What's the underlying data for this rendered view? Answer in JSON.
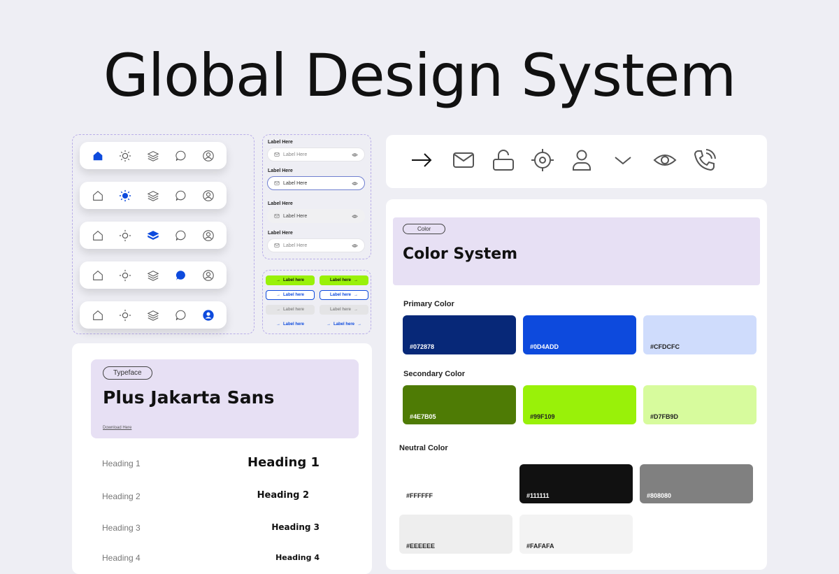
{
  "title": "Global Design System",
  "inputs": {
    "fields": [
      {
        "label": "Label Here",
        "placeholder": "Label Here"
      },
      {
        "label": "Label Here",
        "placeholder": "Label Here"
      },
      {
        "label": "Label Here",
        "placeholder": "Label Here"
      },
      {
        "label": "Label Here",
        "placeholder": "Label Here"
      }
    ]
  },
  "buttons": {
    "labels": [
      "Label here",
      "Label here",
      "Label here",
      "Label here",
      "Label here",
      "Label here",
      "Label here",
      "Label here"
    ]
  },
  "nav_icons": [
    "home-icon",
    "sun-icon",
    "layers-icon",
    "chat-icon",
    "user-circle-icon"
  ],
  "icon_row": [
    "arrow-right-icon",
    "mail-icon",
    "lock-open-icon",
    "target-icon",
    "user-icon",
    "chevron-down-icon",
    "eye-icon",
    "phone-icon"
  ],
  "typeface": {
    "tag": "Typeface",
    "name": "Plus Jakarta Sans",
    "download": "Download Here",
    "headings": [
      {
        "label": "Heading 1",
        "sample": "Heading 1"
      },
      {
        "label": "Heading 2",
        "sample": "Heading 2"
      },
      {
        "label": "Heading 3",
        "sample": "Heading 3"
      },
      {
        "label": "Heading 4",
        "sample": "Heading 4"
      }
    ]
  },
  "colors": {
    "tag": "Color",
    "title": "Color System",
    "primary_label": "Primary Color",
    "primary": [
      "#072878",
      "#0D4ADD",
      "#CFDCFC"
    ],
    "secondary_label": "Secondary Color",
    "secondary": [
      "#4E7B05",
      "#99F109",
      "#D7FB9D"
    ],
    "neutral_label": "Neutral Color",
    "neutral": [
      "#FFFFFF",
      "#111111",
      "#808080",
      "#EEEEEE",
      "#FAFAFA"
    ]
  },
  "accent": "#0D4ADD"
}
